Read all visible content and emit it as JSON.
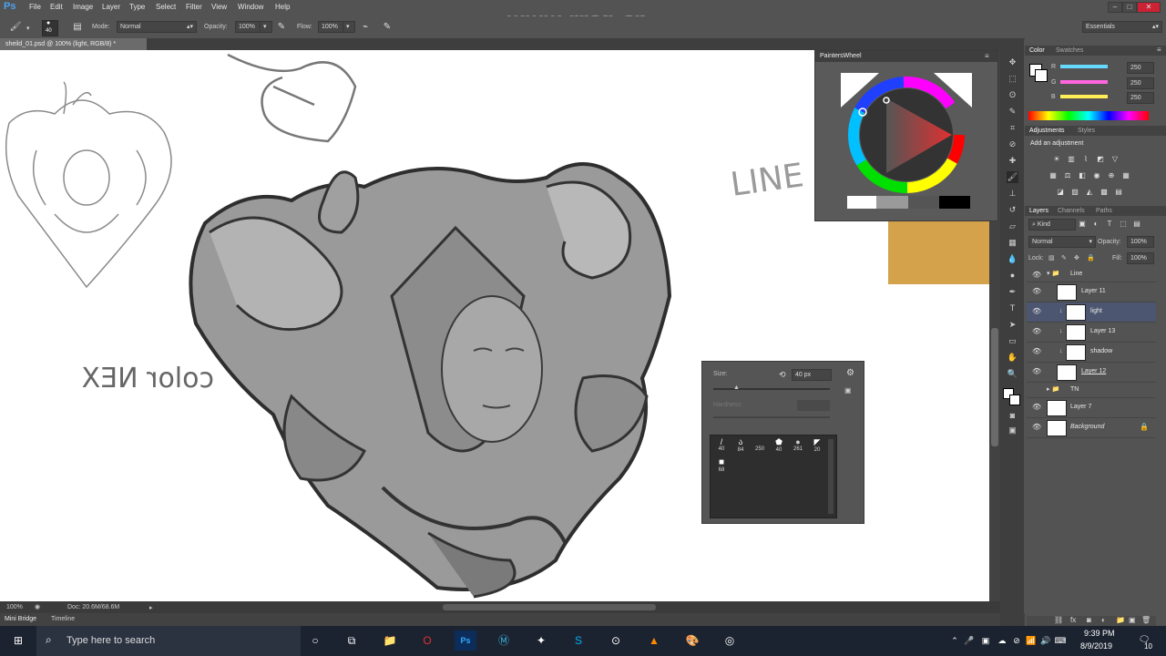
{
  "app": {
    "logo": "Ps",
    "brand_color": "#31a8ff"
  },
  "menu": [
    "File",
    "Edit",
    "Image",
    "Layer",
    "Type",
    "Select",
    "Filter",
    "View",
    "Window",
    "Help"
  ],
  "watermark": "www.rrcg.cn",
  "workspace": "Essentials",
  "options": {
    "brush_size": "40",
    "mode_label": "Mode:",
    "mode_value": "Normal",
    "opacity_label": "Opacity:",
    "opacity_value": "100%",
    "flow_label": "Flow:",
    "flow_value": "100%"
  },
  "document_tab": "sheild_01.psd @ 100% (light, RGB/8) *",
  "status": {
    "zoom": "100%",
    "doc": "Doc: 20.6M/68.6M"
  },
  "bottom_tabs": [
    "Mini Bridge",
    "Timeline"
  ],
  "painters_wheel": {
    "title": "PaintersWheel",
    "base_hue": "#e03030"
  },
  "color_panel": {
    "tabs": [
      "Color",
      "Swatches"
    ],
    "channels": [
      {
        "label": "R",
        "value": "250",
        "color": "#66d9ff"
      },
      {
        "label": "G",
        "value": "250",
        "color": "#ff66e0"
      },
      {
        "label": "B",
        "value": "250",
        "color": "#ffee55"
      }
    ]
  },
  "adjustments": {
    "tabs": [
      "Adjustments",
      "Styles"
    ],
    "title": "Add an adjustment"
  },
  "layers_panel": {
    "tabs": [
      "Layers",
      "Channels",
      "Paths"
    ],
    "kind": "Kind",
    "blend": "Normal",
    "opacity_label": "Opacity:",
    "opacity": "100%",
    "lock_label": "Lock:",
    "fill_label": "Fill:",
    "fill": "100%",
    "layers": [
      {
        "name": "Line",
        "type": "group",
        "selected": false
      },
      {
        "name": "Layer 11",
        "type": "layer",
        "selected": false
      },
      {
        "name": "light",
        "type": "clipped",
        "selected": true
      },
      {
        "name": "Layer 13",
        "type": "clipped",
        "selected": false
      },
      {
        "name": "shadow",
        "type": "clipped",
        "selected": false
      },
      {
        "name": "Layer 12",
        "type": "layer",
        "selected": false
      },
      {
        "name": "TN",
        "type": "group",
        "selected": false
      },
      {
        "name": "Layer 7",
        "type": "layer",
        "selected": false
      },
      {
        "name": "Background",
        "type": "background",
        "selected": false
      }
    ]
  },
  "brush_popup": {
    "size_label": "Size:",
    "size_value": "40 px",
    "hardness_label": "Hardness:",
    "presets": [
      "40",
      "84",
      "250",
      "40",
      "261",
      "20",
      "68"
    ]
  },
  "canvas_text": {
    "line": "LINE",
    "color_next": "color NEX"
  },
  "taskbar": {
    "search_placeholder": "Type here to search",
    "time": "9:39 PM",
    "date": "8/9/2019",
    "notifications": "10"
  }
}
